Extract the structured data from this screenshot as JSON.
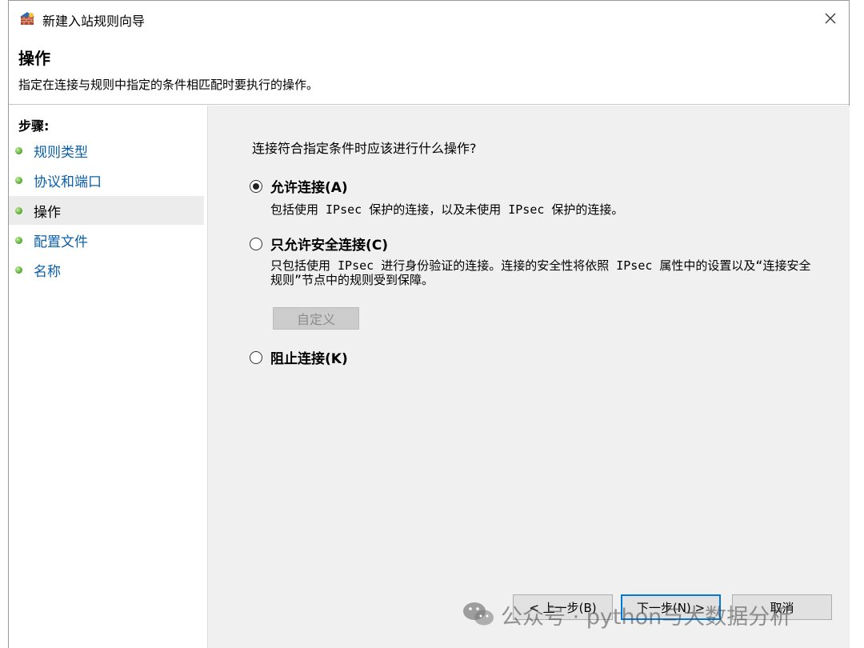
{
  "window": {
    "title": "新建入站规则向导"
  },
  "header": {
    "title": "操作",
    "description": "指定在连接与规则中指定的条件相匹配时要执行的操作。"
  },
  "steps": {
    "label": "步骤:",
    "items": [
      {
        "label": "规则类型"
      },
      {
        "label": "协议和端口"
      },
      {
        "label": "操作",
        "active": true
      },
      {
        "label": "配置文件"
      },
      {
        "label": "名称"
      }
    ]
  },
  "content": {
    "question": "连接符合指定条件时应该进行什么操作?",
    "options": [
      {
        "label": "允许连接(A)",
        "desc": "包括使用 IPsec 保护的连接，以及未使用 IPsec 保护的连接。",
        "selected": true
      },
      {
        "label": "只允许安全连接(C)",
        "desc": "只包括使用 IPsec 进行身份验证的连接。连接的安全性将依照 IPsec 属性中的设置以及“连接安全规则”节点中的规则受到保障。",
        "selected": false
      },
      {
        "label": "阻止连接(K)",
        "selected": false
      }
    ],
    "customize_label": "自定义"
  },
  "footer": {
    "back_label": "< 上一步(B)",
    "next_label": "下一步(N) >",
    "cancel_label": "取消"
  },
  "watermark": {
    "text": "公众号 · python与大数据分析"
  },
  "colors": {
    "accent": "#0078d7",
    "link": "#0b5fa8",
    "content_bg": "#f0f0f0"
  }
}
